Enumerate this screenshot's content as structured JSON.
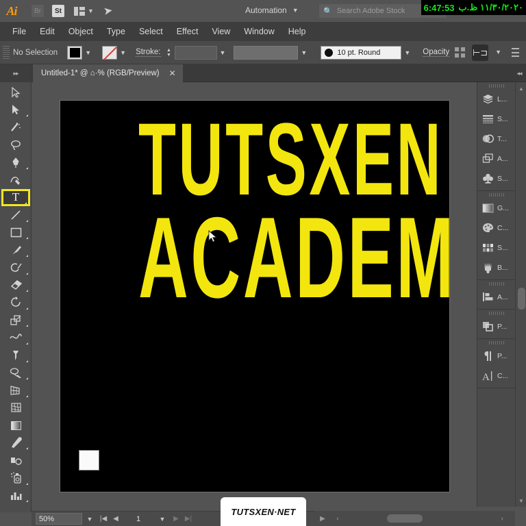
{
  "appbar": {
    "logo": "Ai",
    "bridge_label": "Br",
    "stock_label": "St",
    "arrange_icon": "arrange-documents-icon",
    "rocket_icon": "discover-icon",
    "automation_label": "Automation",
    "search_placeholder": "Search Adobe Stock",
    "search_value": "",
    "timestamp_time": "6:47:53",
    "timestamp_date": "١١/٣٠/٢٠٢٠ ظ.ب"
  },
  "menu": {
    "items": [
      "File",
      "Edit",
      "Object",
      "Type",
      "Select",
      "Effect",
      "View",
      "Window",
      "Help"
    ]
  },
  "control_bar": {
    "selection_status": "No Selection",
    "fill_color": "#000000",
    "stroke_color": "none",
    "stroke_label": "Stroke:",
    "stroke_weight": "",
    "stroke_profile": "",
    "brush_definition": "10 pt. Round",
    "opacity_label": "Opacity",
    "opacity_value": "",
    "align_icon": "align-icon",
    "document_setup_icon": "document-setup-icon",
    "more_options_icon": "more-options-icon"
  },
  "tab_bar": {
    "document_title": "Untitled-1* @ ⌂·% (RGB/Preview)",
    "close_label": "✕",
    "left_collapse": "▸▸",
    "right_collapse": "◂◂"
  },
  "toolbar": {
    "tools": [
      {
        "name": "selection-tool",
        "glyph": "selection",
        "selected": false,
        "has_flyout": false
      },
      {
        "name": "direct-selection-tool",
        "glyph": "direct-selection",
        "selected": false,
        "has_flyout": true
      },
      {
        "name": "magic-wand-tool",
        "glyph": "magic-wand",
        "selected": false,
        "has_flyout": false
      },
      {
        "name": "lasso-tool",
        "glyph": "lasso",
        "selected": false,
        "has_flyout": false
      },
      {
        "name": "pen-tool",
        "glyph": "pen",
        "selected": false,
        "has_flyout": true
      },
      {
        "name": "curvature-tool",
        "glyph": "curvature",
        "selected": false,
        "has_flyout": false
      },
      {
        "name": "type-tool",
        "glyph": "T",
        "selected": true,
        "has_flyout": true
      },
      {
        "name": "line-segment-tool",
        "glyph": "line",
        "selected": false,
        "has_flyout": true
      },
      {
        "name": "rectangle-tool",
        "glyph": "rectangle",
        "selected": false,
        "has_flyout": true
      },
      {
        "name": "paintbrush-tool",
        "glyph": "paintbrush",
        "selected": false,
        "has_flyout": true
      },
      {
        "name": "shaper-tool",
        "glyph": "shaper",
        "selected": false,
        "has_flyout": true
      },
      {
        "name": "eraser-tool",
        "glyph": "eraser",
        "selected": false,
        "has_flyout": true
      },
      {
        "name": "rotate-tool",
        "glyph": "rotate",
        "selected": false,
        "has_flyout": true
      },
      {
        "name": "scale-tool",
        "glyph": "scale",
        "selected": false,
        "has_flyout": true
      },
      {
        "name": "width-tool",
        "glyph": "width",
        "selected": false,
        "has_flyout": true
      },
      {
        "name": "free-transform-tool",
        "glyph": "pin",
        "selected": false,
        "has_flyout": true
      },
      {
        "name": "shape-builder-tool",
        "glyph": "shape-builder",
        "selected": false,
        "has_flyout": true
      },
      {
        "name": "perspective-grid-tool",
        "glyph": "perspective",
        "selected": false,
        "has_flyout": true
      },
      {
        "name": "mesh-tool",
        "glyph": "mesh",
        "selected": false,
        "has_flyout": false
      },
      {
        "name": "gradient-tool",
        "glyph": "gradient",
        "selected": false,
        "has_flyout": false
      },
      {
        "name": "eyedropper-tool",
        "glyph": "eyedropper",
        "selected": false,
        "has_flyout": true
      },
      {
        "name": "blend-tool",
        "glyph": "blend",
        "selected": false,
        "has_flyout": false
      },
      {
        "name": "symbol-sprayer-tool",
        "glyph": "symbol-sprayer",
        "selected": false,
        "has_flyout": true
      },
      {
        "name": "column-graph-tool",
        "glyph": "column-graph",
        "selected": false,
        "has_flyout": true
      }
    ]
  },
  "artboard": {
    "background_color": "#000000",
    "text_color": "#F2E60E",
    "line1": "TUTSXEN",
    "line2": "ACADEMY",
    "white_square": "white-rectangle-object"
  },
  "status_bar": {
    "zoom_level": "50%",
    "artboard_number": "1",
    "first_label": "|◀",
    "prev_label": "◀",
    "next_label": "▶",
    "last_label": "▶|"
  },
  "watermark": {
    "text": "TUTSXEN·NET"
  },
  "dock": {
    "groups": [
      {
        "items": [
          {
            "name": "panel-layers",
            "label": "L...",
            "icon": "layers-icon"
          },
          {
            "name": "panel-stroke",
            "label": "S...",
            "icon": "stroke-icon"
          },
          {
            "name": "panel-transparency",
            "label": "T...",
            "icon": "transparency-icon"
          },
          {
            "name": "panel-artboards",
            "label": "A...",
            "icon": "artboards-icon"
          },
          {
            "name": "panel-symbols",
            "label": "S...",
            "icon": "symbols-icon"
          }
        ]
      },
      {
        "items": [
          {
            "name": "panel-gradient",
            "label": "G...",
            "icon": "gradient-icon"
          },
          {
            "name": "panel-color",
            "label": "C...",
            "icon": "color-palette-icon"
          },
          {
            "name": "panel-swatches",
            "label": "S...",
            "icon": "swatches-icon"
          },
          {
            "name": "panel-brushes",
            "label": "B...",
            "icon": "brushes-icon"
          }
        ]
      },
      {
        "items": [
          {
            "name": "panel-align",
            "label": "A...",
            "icon": "align-panel-icon"
          }
        ]
      },
      {
        "items": [
          {
            "name": "panel-pathfinder",
            "label": "P...",
            "icon": "pathfinder-icon"
          }
        ]
      },
      {
        "items": [
          {
            "name": "panel-paragraph",
            "label": "P...",
            "icon": "paragraph-icon"
          },
          {
            "name": "panel-character",
            "label": "C...",
            "icon": "character-icon"
          }
        ]
      }
    ]
  }
}
